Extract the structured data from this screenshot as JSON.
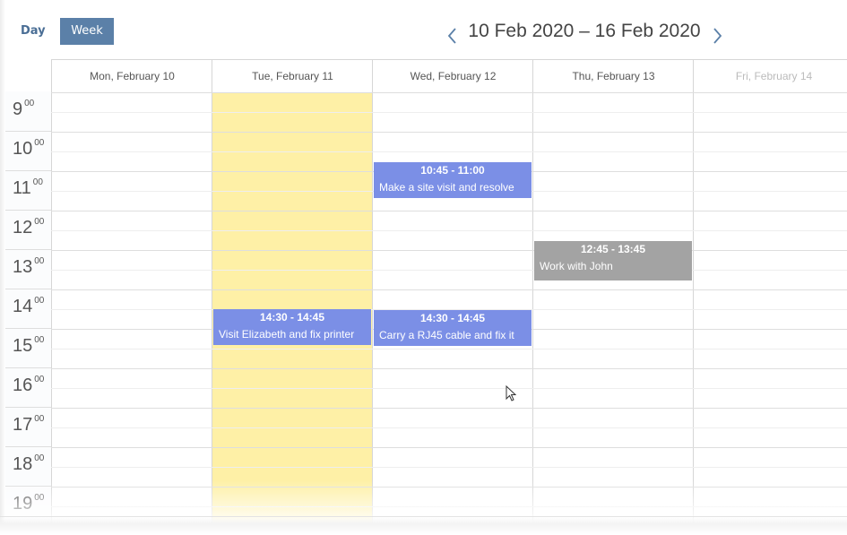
{
  "toolbar": {
    "day_label": "Day",
    "week_label": "Week",
    "date_range": "10 Feb 2020 – 16 Feb 2020",
    "prev_icon": "chevron-left-icon",
    "next_icon": "chevron-right-icon"
  },
  "colors": {
    "accent": "#5b80a8",
    "today": "#fef0a6",
    "event_blue": "#7b8fe6",
    "event_gray": "#a3a3a3"
  },
  "days": [
    {
      "label": "Mon, February 10"
    },
    {
      "label": "Tue, February 11",
      "today": true
    },
    {
      "label": "Wed, February 12"
    },
    {
      "label": "Thu, February 13"
    },
    {
      "label": "Fri, February 14",
      "faded": true
    }
  ],
  "hours": [
    {
      "hour": "9",
      "min": "00"
    },
    {
      "hour": "10",
      "min": "00"
    },
    {
      "hour": "11",
      "min": "00"
    },
    {
      "hour": "12",
      "min": "00"
    },
    {
      "hour": "13",
      "min": "00"
    },
    {
      "hour": "14",
      "min": "00"
    },
    {
      "hour": "15",
      "min": "00"
    },
    {
      "hour": "16",
      "min": "00"
    },
    {
      "hour": "17",
      "min": "00"
    },
    {
      "hour": "18",
      "min": "00"
    },
    {
      "hour": "19",
      "min": "00"
    }
  ],
  "events": [
    {
      "time": "10:45 - 11:00",
      "title": "Make a site visit and resolve",
      "day": 2,
      "color": "blue"
    },
    {
      "time": "12:45 - 13:45",
      "title": "Work with John",
      "day": 3,
      "color": "gray"
    },
    {
      "time": "14:30 - 14:45",
      "title": "Visit Elizabeth and fix printer",
      "day": 1,
      "color": "blue"
    },
    {
      "time": "14:30 - 14:45",
      "title": "Carry a RJ45 cable and fix it",
      "day": 2,
      "color": "blue"
    }
  ]
}
